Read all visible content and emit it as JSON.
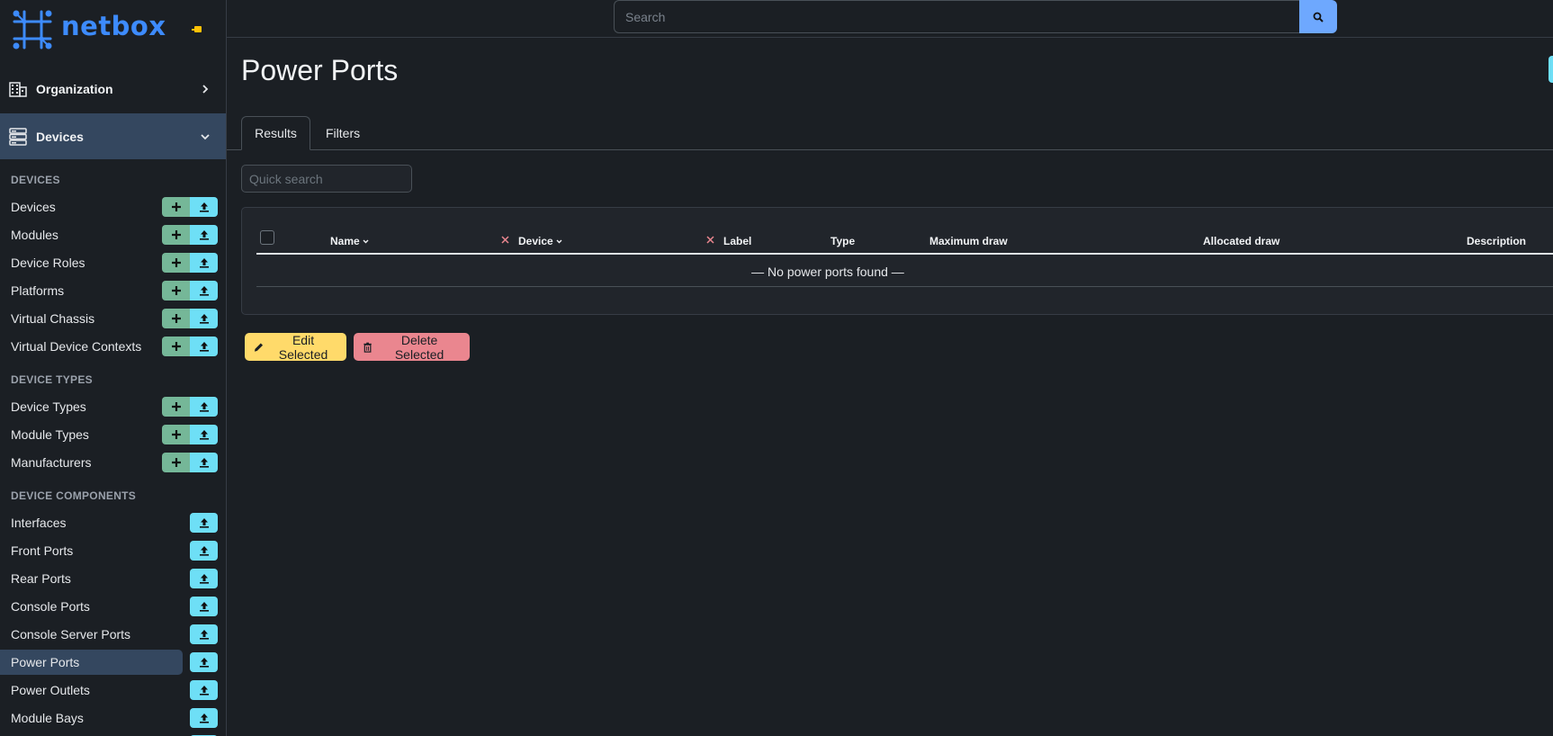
{
  "brand": {
    "name": "netbox"
  },
  "search": {
    "placeholder": "Search"
  },
  "sidebar": {
    "groups": [
      {
        "label": "Organization",
        "icon": "building-icon"
      },
      {
        "label": "Devices",
        "icon": "server-icon"
      }
    ],
    "sections": [
      {
        "heading": "DEVICES"
      },
      {
        "heading": "DEVICE TYPES"
      },
      {
        "heading": "DEVICE COMPONENTS"
      }
    ],
    "items": [
      {
        "label": "Devices"
      },
      {
        "label": "Modules"
      },
      {
        "label": "Device Roles"
      },
      {
        "label": "Platforms"
      },
      {
        "label": "Virtual Chassis"
      },
      {
        "label": "Virtual Device Contexts"
      },
      {
        "label": "Device Types"
      },
      {
        "label": "Module Types"
      },
      {
        "label": "Manufacturers"
      },
      {
        "label": "Interfaces"
      },
      {
        "label": "Front Ports"
      },
      {
        "label": "Rear Ports"
      },
      {
        "label": "Console Ports"
      },
      {
        "label": "Console Server Ports"
      },
      {
        "label": "Power Ports"
      },
      {
        "label": "Power Outlets"
      },
      {
        "label": "Module Bays"
      }
    ]
  },
  "page": {
    "title": "Power Ports",
    "tabs": [
      {
        "label": "Results"
      },
      {
        "label": "Filters"
      }
    ],
    "quick_search_placeholder": "Quick search"
  },
  "table": {
    "columns": [
      {
        "label": "Name"
      },
      {
        "label": "Device"
      },
      {
        "label": "Label"
      },
      {
        "label": "Type"
      },
      {
        "label": "Maximum draw"
      },
      {
        "label": "Allocated draw"
      },
      {
        "label": "Description"
      }
    ],
    "empty_message": "— No power ports found —"
  },
  "actions": {
    "edit_label": "Edit Selected",
    "delete_label": "Delete Selected"
  },
  "colors": {
    "accent": "#3d8bfd",
    "add": "#75b798",
    "import": "#6edff6",
    "edit": "#ffda6a",
    "delete": "#ea868f"
  }
}
